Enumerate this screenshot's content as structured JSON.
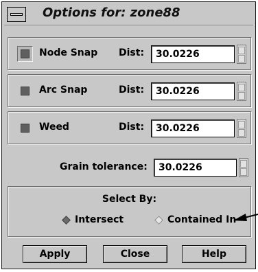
{
  "window": {
    "title": "Options for: zone88"
  },
  "rows": [
    {
      "checkbox_label": "Node Snap",
      "dist_label": "Dist:",
      "value": "30.0226"
    },
    {
      "checkbox_label": "Arc Snap",
      "dist_label": "Dist:",
      "value": "30.0226"
    },
    {
      "checkbox_label": "Weed",
      "dist_label": "Dist:",
      "value": "30.0226"
    }
  ],
  "grain": {
    "label": "Grain tolerance:",
    "value": "30.0226"
  },
  "select_by": {
    "label": "Select By:",
    "options": [
      "Intersect",
      "Contained In"
    ],
    "selected": "Intersect"
  },
  "buttons": {
    "apply": "Apply",
    "close": "Close",
    "help": "Help"
  }
}
